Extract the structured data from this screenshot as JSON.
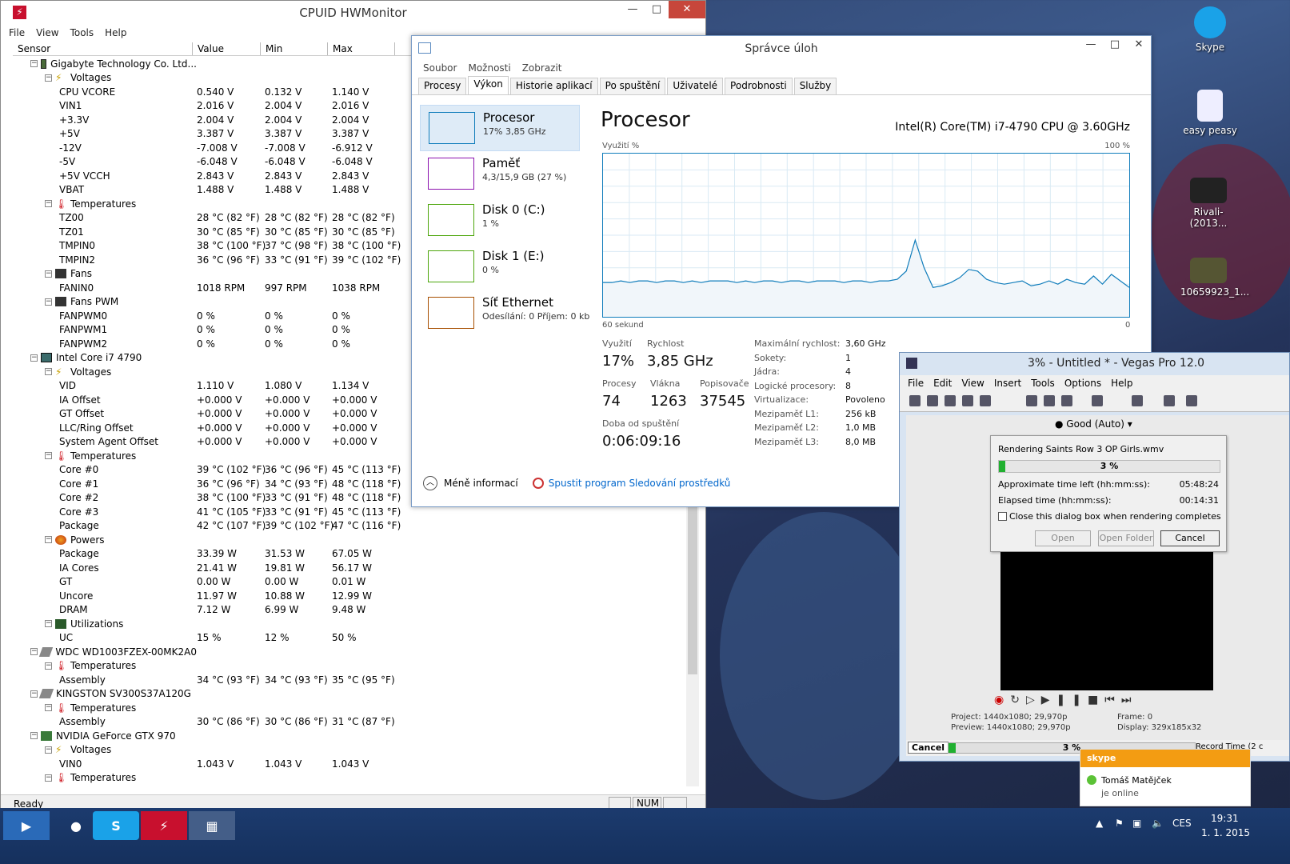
{
  "hwmonitor": {
    "title": "CPUID HWMonitor",
    "menu": [
      "File",
      "View",
      "Tools",
      "Help"
    ],
    "columns": [
      "Sensor",
      "Value",
      "Min",
      "Max"
    ],
    "rows": [
      {
        "lvl": 0,
        "exp": "−",
        "icon": "mb",
        "name": "Gigabyte Technology Co. Ltd...",
        "v": "",
        "mn": "",
        "mx": ""
      },
      {
        "lvl": 1,
        "exp": "−",
        "icon": "volt",
        "name": "Voltages",
        "v": "",
        "mn": "",
        "mx": ""
      },
      {
        "lvl": 2,
        "name": "CPU VCORE",
        "v": "0.540 V",
        "mn": "0.132 V",
        "mx": "1.140 V"
      },
      {
        "lvl": 2,
        "name": "VIN1",
        "v": "2.016 V",
        "mn": "2.004 V",
        "mx": "2.016 V"
      },
      {
        "lvl": 2,
        "name": "+3.3V",
        "v": "2.004 V",
        "mn": "2.004 V",
        "mx": "2.004 V"
      },
      {
        "lvl": 2,
        "name": "+5V",
        "v": "3.387 V",
        "mn": "3.387 V",
        "mx": "3.387 V"
      },
      {
        "lvl": 2,
        "name": "-12V",
        "v": "-7.008 V",
        "mn": "-7.008 V",
        "mx": "-6.912 V"
      },
      {
        "lvl": 2,
        "name": "-5V",
        "v": "-6.048 V",
        "mn": "-6.048 V",
        "mx": "-6.048 V"
      },
      {
        "lvl": 2,
        "name": "+5V VCCH",
        "v": "2.843 V",
        "mn": "2.843 V",
        "mx": "2.843 V"
      },
      {
        "lvl": 2,
        "name": "VBAT",
        "v": "1.488 V",
        "mn": "1.488 V",
        "mx": "1.488 V"
      },
      {
        "lvl": 1,
        "exp": "−",
        "icon": "temp",
        "name": "Temperatures",
        "v": "",
        "mn": "",
        "mx": ""
      },
      {
        "lvl": 2,
        "name": "TZ00",
        "v": "28 °C  (82 °F)",
        "mn": "28 °C  (82 °F)",
        "mx": "28 °C  (82 °F)"
      },
      {
        "lvl": 2,
        "name": "TZ01",
        "v": "30 °C  (85 °F)",
        "mn": "30 °C  (85 °F)",
        "mx": "30 °C  (85 °F)"
      },
      {
        "lvl": 2,
        "name": "TMPIN0",
        "v": "38 °C  (100 °F)",
        "mn": "37 °C  (98 °F)",
        "mx": "38 °C  (100 °F)"
      },
      {
        "lvl": 2,
        "name": "TMPIN2",
        "v": "36 °C  (96 °F)",
        "mn": "33 °C  (91 °F)",
        "mx": "39 °C  (102 °F)"
      },
      {
        "lvl": 1,
        "exp": "−",
        "icon": "fan",
        "name": "Fans",
        "v": "",
        "mn": "",
        "mx": ""
      },
      {
        "lvl": 2,
        "name": "FANIN0",
        "v": "1018 RPM",
        "mn": "997 RPM",
        "mx": "1038 RPM"
      },
      {
        "lvl": 1,
        "exp": "−",
        "icon": "fan",
        "name": "Fans PWM",
        "v": "",
        "mn": "",
        "mx": ""
      },
      {
        "lvl": 2,
        "name": "FANPWM0",
        "v": "0 %",
        "mn": "0 %",
        "mx": "0 %"
      },
      {
        "lvl": 2,
        "name": "FANPWM1",
        "v": "0 %",
        "mn": "0 %",
        "mx": "0 %"
      },
      {
        "lvl": 2,
        "name": "FANPWM2",
        "v": "0 %",
        "mn": "0 %",
        "mx": "0 %"
      },
      {
        "lvl": 0,
        "exp": "−",
        "icon": "cpu",
        "name": "Intel Core i7 4790",
        "v": "",
        "mn": "",
        "mx": ""
      },
      {
        "lvl": 1,
        "exp": "−",
        "icon": "volt",
        "name": "Voltages",
        "v": "",
        "mn": "",
        "mx": ""
      },
      {
        "lvl": 2,
        "name": "VID",
        "v": "1.110 V",
        "mn": "1.080 V",
        "mx": "1.134 V"
      },
      {
        "lvl": 2,
        "name": "IA Offset",
        "v": "+0.000 V",
        "mn": "+0.000 V",
        "mx": "+0.000 V"
      },
      {
        "lvl": 2,
        "name": "GT Offset",
        "v": "+0.000 V",
        "mn": "+0.000 V",
        "mx": "+0.000 V"
      },
      {
        "lvl": 2,
        "name": "LLC/Ring Offset",
        "v": "+0.000 V",
        "mn": "+0.000 V",
        "mx": "+0.000 V"
      },
      {
        "lvl": 2,
        "name": "System Agent Offset",
        "v": "+0.000 V",
        "mn": "+0.000 V",
        "mx": "+0.000 V"
      },
      {
        "lvl": 1,
        "exp": "−",
        "icon": "temp",
        "name": "Temperatures",
        "v": "",
        "mn": "",
        "mx": ""
      },
      {
        "lvl": 2,
        "name": "Core #0",
        "v": "39 °C  (102 °F)",
        "mn": "36 °C  (96 °F)",
        "mx": "45 °C  (113 °F)"
      },
      {
        "lvl": 2,
        "name": "Core #1",
        "v": "36 °C  (96 °F)",
        "mn": "34 °C  (93 °F)",
        "mx": "48 °C  (118 °F)"
      },
      {
        "lvl": 2,
        "name": "Core #2",
        "v": "38 °C  (100 °F)",
        "mn": "33 °C  (91 °F)",
        "mx": "48 °C  (118 °F)"
      },
      {
        "lvl": 2,
        "name": "Core #3",
        "v": "41 °C  (105 °F)",
        "mn": "33 °C  (91 °F)",
        "mx": "45 °C  (113 °F)"
      },
      {
        "lvl": 2,
        "name": "Package",
        "v": "42 °C  (107 °F)",
        "mn": "39 °C  (102 °F)",
        "mx": "47 °C  (116 °F)"
      },
      {
        "lvl": 1,
        "exp": "−",
        "icon": "pow",
        "name": "Powers",
        "v": "",
        "mn": "",
        "mx": ""
      },
      {
        "lvl": 2,
        "name": "Package",
        "v": "33.39 W",
        "mn": "31.53 W",
        "mx": "67.05 W"
      },
      {
        "lvl": 2,
        "name": "IA Cores",
        "v": "21.41 W",
        "mn": "19.81 W",
        "mx": "56.17 W"
      },
      {
        "lvl": 2,
        "name": "GT",
        "v": "0.00 W",
        "mn": "0.00 W",
        "mx": "0.01 W"
      },
      {
        "lvl": 2,
        "name": "Uncore",
        "v": "11.97 W",
        "mn": "10.88 W",
        "mx": "12.99 W"
      },
      {
        "lvl": 2,
        "name": "DRAM",
        "v": "7.12 W",
        "mn": "6.99 W",
        "mx": "9.48 W"
      },
      {
        "lvl": 1,
        "exp": "−",
        "icon": "util",
        "name": "Utilizations",
        "v": "",
        "mn": "",
        "mx": ""
      },
      {
        "lvl": 2,
        "name": "UC",
        "v": "15 %",
        "mn": "12 %",
        "mx": "50 %"
      },
      {
        "lvl": 0,
        "exp": "−",
        "icon": "hdd",
        "name": "WDC WD1003FZEX-00MK2A0",
        "v": "",
        "mn": "",
        "mx": ""
      },
      {
        "lvl": 1,
        "exp": "−",
        "icon": "temp",
        "name": "Temperatures",
        "v": "",
        "mn": "",
        "mx": ""
      },
      {
        "lvl": 2,
        "name": "Assembly",
        "v": "34 °C  (93 °F)",
        "mn": "34 °C  (93 °F)",
        "mx": "35 °C  (95 °F)"
      },
      {
        "lvl": 0,
        "exp": "−",
        "icon": "hdd",
        "name": "KINGSTON SV300S37A120G",
        "v": "",
        "mn": "",
        "mx": ""
      },
      {
        "lvl": 1,
        "exp": "−",
        "icon": "temp",
        "name": "Temperatures",
        "v": "",
        "mn": "",
        "mx": ""
      },
      {
        "lvl": 2,
        "name": "Assembly",
        "v": "30 °C  (86 °F)",
        "mn": "30 °C  (86 °F)",
        "mx": "31 °C  (87 °F)"
      },
      {
        "lvl": 0,
        "exp": "−",
        "icon": "gpu",
        "name": "NVIDIA GeForce GTX 970",
        "v": "",
        "mn": "",
        "mx": ""
      },
      {
        "lvl": 1,
        "exp": "−",
        "icon": "volt",
        "name": "Voltages",
        "v": "",
        "mn": "",
        "mx": ""
      },
      {
        "lvl": 2,
        "name": "VIN0",
        "v": "1.043 V",
        "mn": "1.043 V",
        "mx": "1.043 V"
      },
      {
        "lvl": 1,
        "exp": "−",
        "icon": "temp",
        "name": "Temperatures",
        "v": "",
        "mn": "",
        "mx": ""
      }
    ],
    "status": "Ready",
    "num": "NUM"
  },
  "taskmgr": {
    "title": "Správce úloh",
    "menu": [
      "Soubor",
      "Možnosti",
      "Zobrazit"
    ],
    "tabs": [
      "Procesy",
      "Výkon",
      "Historie aplikací",
      "Po spuštění",
      "Uživatelé",
      "Podrobnosti",
      "Služby"
    ],
    "side": [
      {
        "name": "Procesor",
        "sub": "17%  3,85 GHz",
        "color": "#117dbb"
      },
      {
        "name": "Paměť",
        "sub": "4,3/15,9 GB (27 %)",
        "color": "#8b12ae"
      },
      {
        "name": "Disk 0 (C:)",
        "sub": "1 %",
        "color": "#4da60c"
      },
      {
        "name": "Disk 1 (E:)",
        "sub": "0 %",
        "color": "#4da60c"
      },
      {
        "name": "Síť Ethernet",
        "sub": "Odesílání: 0  Příjem: 0 kb",
        "color": "#a74f01"
      }
    ],
    "heading": "Procesor",
    "cpu_name": "Intel(R) Core(TM) i7-4790 CPU @ 3.60GHz",
    "graph_label": "Využití %",
    "graph_max": "100 %",
    "graph_span": "60 sekund",
    "graph_min": "0",
    "usage_series": [
      21,
      21,
      22,
      21,
      22,
      22,
      21,
      22,
      22,
      21,
      22,
      21,
      22,
      22,
      22,
      21,
      22,
      21,
      22,
      22,
      21,
      22,
      22,
      21,
      22,
      22,
      22,
      21,
      22,
      22,
      21,
      22,
      22,
      23,
      28,
      47,
      30,
      18,
      19,
      21,
      24,
      29,
      28,
      23,
      21,
      20,
      21,
      22,
      19,
      20,
      22,
      20,
      23,
      21,
      20,
      25,
      20,
      26,
      22,
      18
    ],
    "stats": [
      {
        "lb": "Využití",
        "vl": "17%"
      },
      {
        "lb": "Rychlost",
        "vl": "3,85 GHz"
      },
      {
        "lb": "Procesy",
        "vl": "74"
      },
      {
        "lb": "Vlákna",
        "vl": "1263"
      },
      {
        "lb": "Popisovače",
        "vl": "37545"
      },
      {
        "lb": "Doba od spuštění",
        "vl": "0:06:09:16"
      }
    ],
    "kv": [
      [
        "Maximální rychlost:",
        "3,60 GHz"
      ],
      [
        "Sokety:",
        "1"
      ],
      [
        "Jádra:",
        "4"
      ],
      [
        "Logické procesory:",
        "8"
      ],
      [
        "Virtualizace:",
        "Povoleno"
      ],
      [
        "Mezipaměť L1:",
        "256 kB"
      ],
      [
        "Mezipaměť L2:",
        "1,0 MB"
      ],
      [
        "Mezipaměť L3:",
        "8,0 MB"
      ]
    ],
    "less_info": "Méně informací",
    "monitor_link": "Spustit program Sledování prostředků"
  },
  "vegas": {
    "title": "3% - Untitled * - Vegas Pro 12.0",
    "menu": [
      "File",
      "Edit",
      "View",
      "Insert",
      "Tools",
      "Options",
      "Help"
    ],
    "quality": "Good (Auto)",
    "dialog": {
      "rendering": "Rendering Saints Row 3 OP Girls.wmv",
      "percent": "3 %",
      "progress": 0.03,
      "approx_label": "Approximate time left (hh:mm:ss):",
      "approx_val": "05:48:24",
      "elapsed_label": "Elapsed time (hh:mm:ss):",
      "elapsed_val": "00:14:31",
      "close_check": "Close this dialog box when rendering completes",
      "open": "Open",
      "open_folder": "Open Folder",
      "cancel": "Cancel"
    },
    "project": "Project:  1440x1080; 29,970p",
    "preview": "Preview:  1440x1080; 29,970p",
    "frame": "Frame:     0",
    "display": "Display:   329x185x32",
    "cancel_btn": "Cancel",
    "bottom_pct": "3 %",
    "record_time": "Record Time (2 c"
  },
  "toast": {
    "brand": "skype",
    "name": "Tomáš Matějček",
    "status": "je online"
  },
  "desktop_icons": [
    {
      "label": "Skype"
    },
    {
      "label": "easy peasy"
    },
    {
      "label": "Rivali-(2013..."
    },
    {
      "label": "10659923_1..."
    }
  ],
  "tray": {
    "lang": "CES",
    "time": "19:31",
    "date": "1. 1. 2015"
  }
}
